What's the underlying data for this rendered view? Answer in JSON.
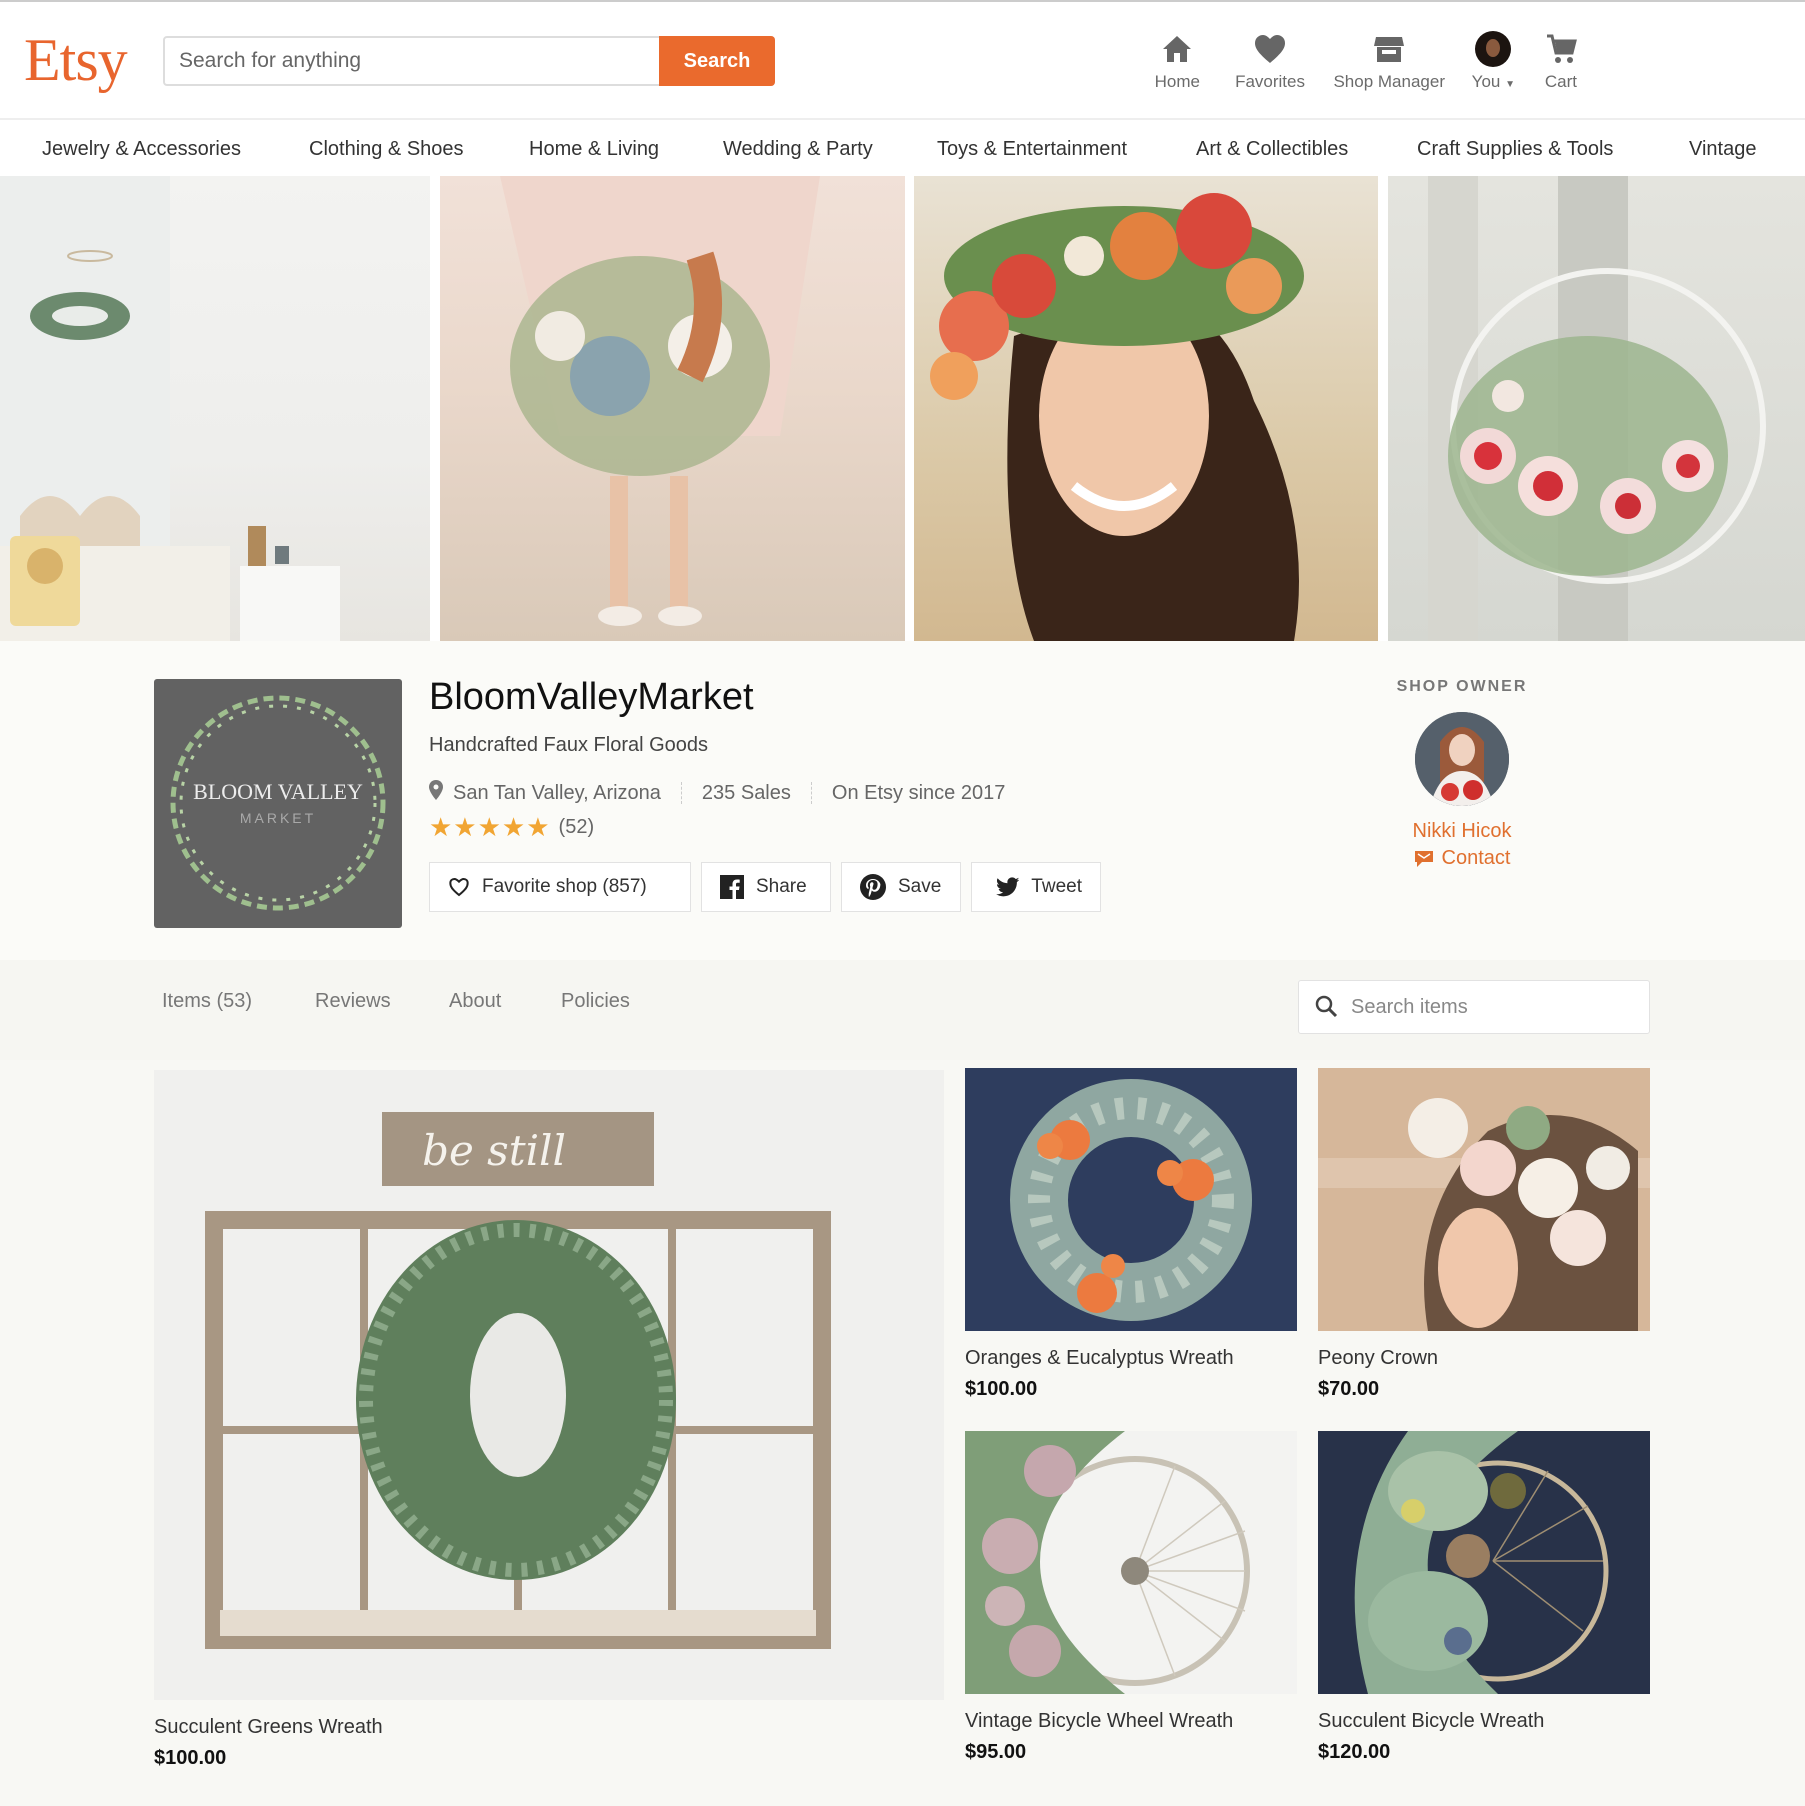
{
  "header": {
    "logo": "Etsy",
    "search_placeholder": "Search for anything",
    "search_button": "Search",
    "nav": [
      {
        "label": "Home",
        "icon": "home-icon"
      },
      {
        "label": "Favorites",
        "icon": "heart-icon"
      },
      {
        "label": "Shop Manager",
        "icon": "storefront-icon"
      },
      {
        "label": "You",
        "icon": "avatar"
      },
      {
        "label": "Cart",
        "icon": "cart-icon"
      }
    ]
  },
  "categories": [
    "Jewelry & Accessories",
    "Clothing & Shoes",
    "Home & Living",
    "Wedding & Party",
    "Toys & Entertainment",
    "Art & Collectibles",
    "Craft Supplies & Tools",
    "Vintage"
  ],
  "shop": {
    "logo_line1": "BLOOM VALLEY",
    "logo_line2": "MARKET",
    "name": "BloomValleyMarket",
    "tagline": "Handcrafted Faux Floral Goods",
    "location": "San Tan Valley, Arizona",
    "sales": "235 Sales",
    "since": "On Etsy since 2017",
    "stars": "★★★★★",
    "rating_value": 5,
    "review_count": "(52)",
    "actions": {
      "favorite": "Favorite shop (857)",
      "share": "Share",
      "save": "Save",
      "tweet": "Tweet"
    }
  },
  "owner": {
    "heading": "SHOP OWNER",
    "name": "Nikki Hicok",
    "contact": "Contact"
  },
  "tabs": [
    "Items (53)",
    "Reviews",
    "About",
    "Policies"
  ],
  "item_search_placeholder": "Search items",
  "listings": [
    {
      "title": "Succulent Greens Wreath",
      "price": "$100.00"
    },
    {
      "title": "Oranges & Eucalyptus Wreath",
      "price": "$100.00"
    },
    {
      "title": "Peony Crown",
      "price": "$70.00"
    },
    {
      "title": "Vintage Bicycle Wheel Wreath",
      "price": "$95.00"
    },
    {
      "title": "Succulent Bicycle Wreath",
      "price": "$120.00"
    }
  ],
  "colors": {
    "brand": "#ea6a2d",
    "owner_link": "#e0702f",
    "star": "#f1a533"
  }
}
